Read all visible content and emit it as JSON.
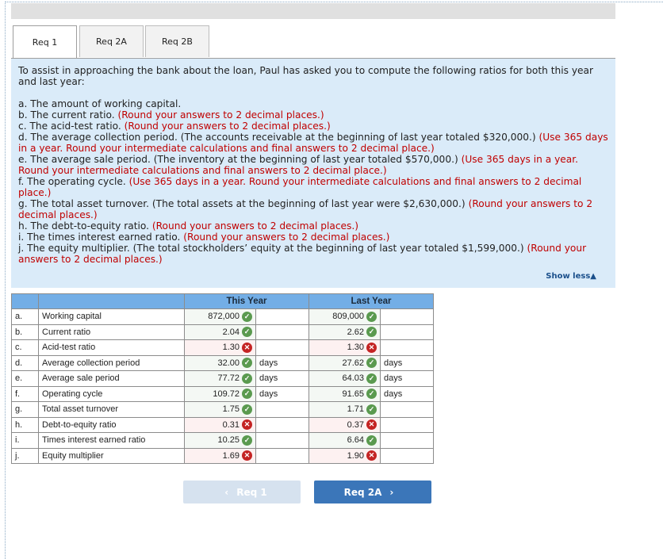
{
  "tabs": [
    {
      "label": "Req 1",
      "active": true
    },
    {
      "label": "Req 2A",
      "active": false
    },
    {
      "label": "Req 2B",
      "active": false
    }
  ],
  "instructions": {
    "intro": "To assist in approaching the bank about the loan, Paul has asked you to compute the following ratios for both this year and last year:",
    "items": [
      {
        "text": "a. The amount of working capital.",
        "note": ""
      },
      {
        "text": "b. The current ratio.",
        "note": "(Round your answers to 2 decimal places.)"
      },
      {
        "text": "c. The acid-test ratio.",
        "note": "(Round your answers to 2 decimal places.)"
      },
      {
        "text": "d. The average collection period. (The accounts receivable at the beginning of last year totaled $320,000.)",
        "note": "(Use 365 days in a year. Round your intermediate calculations and final answers to 2 decimal place.)"
      },
      {
        "text": "e. The average sale period. (The inventory at the beginning of last year totaled $570,000.)",
        "note": "(Use 365 days in a year. Round your intermediate calculations and final answers to 2 decimal place.)"
      },
      {
        "text": "f. The operating cycle.",
        "note": "(Use 365 days in a year. Round your intermediate calculations and final answers to 2 decimal place.)"
      },
      {
        "text": "g. The total asset turnover. (The total assets at the beginning of last year were $2,630,000.)",
        "note": "(Round your answers to 2 decimal places.)"
      },
      {
        "text": "h. The debt-to-equity ratio.",
        "note": "(Round your answers to 2 decimal places.)"
      },
      {
        "text": "i. The times interest earned ratio.",
        "note": "(Round your answers to 2 decimal places.)"
      },
      {
        "text": "j. The equity multiplier. (The total stockholders’ equity at the beginning of last year totaled $1,599,000.)",
        "note": "(Round your answers to 2 decimal places.)"
      }
    ],
    "show_less": "Show less",
    "show_less_icon": "▲"
  },
  "table": {
    "headers": {
      "this_year": "This Year",
      "last_year": "Last Year"
    },
    "rows": [
      {
        "letter": "a.",
        "label": "Working capital",
        "this_year": {
          "value": "872,000",
          "status": "correct",
          "unit": ""
        },
        "last_year": {
          "value": "809,000",
          "status": "correct",
          "unit": ""
        }
      },
      {
        "letter": "b.",
        "label": "Current ratio",
        "this_year": {
          "value": "2.04",
          "status": "correct",
          "unit": ""
        },
        "last_year": {
          "value": "2.62",
          "status": "correct",
          "unit": ""
        }
      },
      {
        "letter": "c.",
        "label": "Acid-test ratio",
        "this_year": {
          "value": "1.30",
          "status": "incorrect",
          "unit": ""
        },
        "last_year": {
          "value": "1.30",
          "status": "incorrect",
          "unit": ""
        }
      },
      {
        "letter": "d.",
        "label": "Average collection period",
        "this_year": {
          "value": "32.00",
          "status": "correct",
          "unit": "days"
        },
        "last_year": {
          "value": "27.62",
          "status": "correct",
          "unit": "days"
        }
      },
      {
        "letter": "e.",
        "label": "Average sale period",
        "this_year": {
          "value": "77.72",
          "status": "correct",
          "unit": "days"
        },
        "last_year": {
          "value": "64.03",
          "status": "correct",
          "unit": "days"
        }
      },
      {
        "letter": "f.",
        "label": "Operating cycle",
        "this_year": {
          "value": "109.72",
          "status": "correct",
          "unit": "days"
        },
        "last_year": {
          "value": "91.65",
          "status": "correct",
          "unit": "days"
        }
      },
      {
        "letter": "g.",
        "label": "Total asset turnover",
        "this_year": {
          "value": "1.75",
          "status": "correct",
          "unit": ""
        },
        "last_year": {
          "value": "1.71",
          "status": "correct",
          "unit": ""
        }
      },
      {
        "letter": "h.",
        "label": "Debt-to-equity ratio",
        "this_year": {
          "value": "0.31",
          "status": "incorrect",
          "unit": ""
        },
        "last_year": {
          "value": "0.37",
          "status": "incorrect",
          "unit": ""
        }
      },
      {
        "letter": "i.",
        "label": "Times interest earned ratio",
        "this_year": {
          "value": "10.25",
          "status": "correct",
          "unit": ""
        },
        "last_year": {
          "value": "6.64",
          "status": "correct",
          "unit": ""
        }
      },
      {
        "letter": "j.",
        "label": "Equity multiplier",
        "this_year": {
          "value": "1.69",
          "status": "incorrect",
          "unit": ""
        },
        "last_year": {
          "value": "1.90",
          "status": "incorrect",
          "unit": ""
        }
      }
    ]
  },
  "nav": {
    "prev_label": "Req 1",
    "prev_icon": "‹",
    "next_label": "Req 2A",
    "next_icon": "›"
  },
  "icons": {
    "correct": "✓",
    "incorrect": "✕"
  },
  "colors": {
    "correct": "#5a9a4f",
    "incorrect": "#c42323",
    "accent": "#3b76b9",
    "note": "#c00000"
  }
}
